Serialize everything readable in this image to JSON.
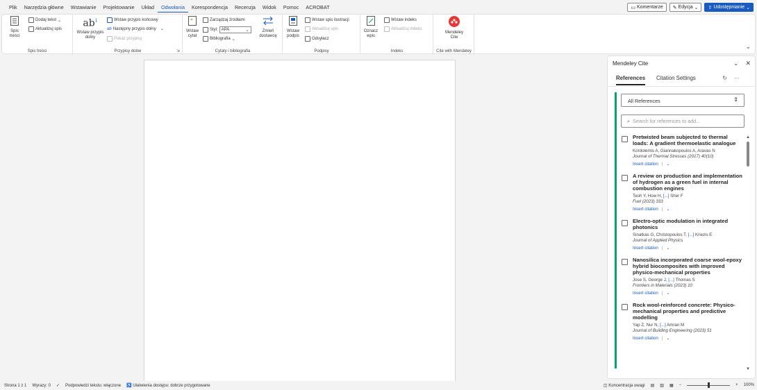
{
  "menu": {
    "tabs": [
      {
        "label": "Plik",
        "active": false
      },
      {
        "label": "Narzędzia główne",
        "active": false
      },
      {
        "label": "Wstawianie",
        "active": false
      },
      {
        "label": "Projektowanie",
        "active": false
      },
      {
        "label": "Układ",
        "active": false
      },
      {
        "label": "Odwołania",
        "active": true
      },
      {
        "label": "Korespondencja",
        "active": false
      },
      {
        "label": "Recenzja",
        "active": false
      },
      {
        "label": "Widok",
        "active": false
      },
      {
        "label": "Pomoc",
        "active": false
      },
      {
        "label": "ACROBAT",
        "active": false
      }
    ],
    "comments_label": "Komentarze",
    "edit_label": "Edycja",
    "share_label": "Udostępnianie"
  },
  "ribbon": {
    "toc": {
      "group_label": "Spis treści",
      "toc_button": "Spis treści",
      "add_text": "Dodaj tekst",
      "update_toc": "Aktualizuj spis"
    },
    "footnotes": {
      "group_label": "Przypisy dolne",
      "insert_footnote": "Wstaw przypis dolny",
      "insert_endnote": "Wstaw przypis końcowy",
      "next_footnote": "Następny przypis dolny",
      "show_notes": "Pokaż przypisy"
    },
    "citations": {
      "group_label": "Cytaty i bibliografia",
      "insert_citation": "Wstaw cytat",
      "manage_sources": "Zarządzaj źródłami",
      "style_label": "Styl:",
      "style_value": "APA",
      "bibliography": "Bibliografia",
      "change_provider": "Zmień dostawcę"
    },
    "captions": {
      "group_label": "Podpisy",
      "insert_caption": "Wstaw podpis",
      "insert_tof": "Wstaw spis ilustracji",
      "update_table": "Aktualizuj spis",
      "cross_ref": "Odsyłacz"
    },
    "index": {
      "group_label": "Indeks",
      "mark_entry": "Oznacz wpis",
      "insert_index": "Wstaw indeks",
      "update_index": "Aktualizuj indeks"
    },
    "mendeley": {
      "group_label": "Cite with Mendeley",
      "button": "Mendeley Cite"
    }
  },
  "pane": {
    "title": "Mendeley Cite",
    "tabs": [
      {
        "label": "References",
        "active": true
      },
      {
        "label": "Citation Settings",
        "active": false
      }
    ],
    "filter_value": "All References",
    "search_placeholder": "Search for references to add...",
    "insert_label": "Insert citation",
    "references": [
      {
        "title": "Pretwisted beam subjected to thermal loads: A gradient thermoelastic analogue",
        "authors": "Kordolemis A, Giannakopoulos A, Aravas N",
        "ellipsis": "",
        "authors_end": "",
        "journal": "Journal of Thermal Stresses (2017) 40(10)"
      },
      {
        "title": "A review on production and implementation of hydrogen as a green fuel in internal combustion engines",
        "authors": "Teoh Y, How H, ",
        "ellipsis": "[...]",
        "authors_end": " Sher F",
        "journal": "Fuel (2023) 333"
      },
      {
        "title": "Electro-optic modulation in integrated photonics",
        "authors": "Sinatkas G, Christopoulos T, ",
        "ellipsis": "[...]",
        "authors_end": " Kriezis E",
        "journal": "Journal of Applied Physics"
      },
      {
        "title": "Nanosilica incorporated coarse wool-epoxy hybrid biocomposites with improved physico-mechanical properties",
        "authors": "Jose S, George J, ",
        "ellipsis": "[...]",
        "authors_end": " Thomas S",
        "journal": "Frontiers in Materials (2023) 10"
      },
      {
        "title": "Rock wool-reinforced concrete: Physico-mechanical properties and predictive modelling",
        "authors": "Yap Z, Nur N, ",
        "ellipsis": "[...]",
        "authors_end": " Amran M",
        "journal": "Journal of Building Engineering (2023) 51"
      }
    ]
  },
  "status": {
    "page": "Strona 1 z 1",
    "words": "Wyrazy: 0",
    "predictions": "Podpowiedzi tekstu: włączone",
    "accessibility": "Ułatwienia dostępu: dobrze przygotowane",
    "focus": "Koncentracja uwagi",
    "zoom": "100%",
    "zoom_fraction": 0.5
  },
  "colors": {
    "accent": "#185abd",
    "mendeley_red": "#e53935",
    "green_bar": "#00a66a"
  }
}
